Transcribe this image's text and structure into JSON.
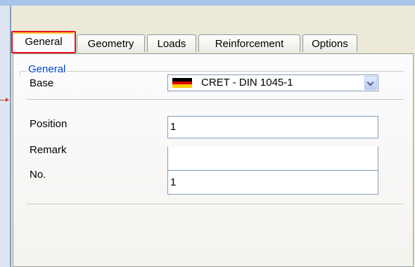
{
  "tabs": [
    "General",
    "Geometry",
    "Loads",
    "Reinforcement",
    "Options"
  ],
  "active_tab": "General",
  "group": {
    "title": "General",
    "base_label": "Base",
    "base_value": "CRET - DIN 1045-1",
    "base_flag_colors": [
      "#000000",
      "#dd0000",
      "#ffce00"
    ],
    "position_label": "Position",
    "position_value": "1",
    "remark_label": "Remark",
    "remark_value": "",
    "no_label": "No.",
    "no_value": "1"
  },
  "colors": {
    "highlight_box": "#e8131c",
    "group_title": "#0046d5",
    "title_bar": "#a9c4ea"
  }
}
